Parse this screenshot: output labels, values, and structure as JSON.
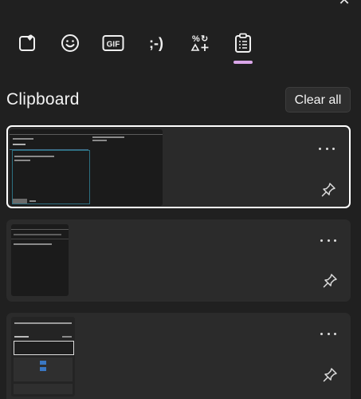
{
  "window": {
    "close_glyph": "✕"
  },
  "tabs": [
    {
      "name": "stickers",
      "icon": "heart-sticker-icon"
    },
    {
      "name": "emoji",
      "icon": "smiley-icon"
    },
    {
      "name": "gif",
      "label": "GIF",
      "icon": "gif-icon"
    },
    {
      "name": "kaomoji",
      "label": ";-)",
      "icon": "kaomoji-icon"
    },
    {
      "name": "symbols",
      "icon": "symbols-icon"
    },
    {
      "name": "clipboard",
      "icon": "clipboard-icon",
      "selected": true
    }
  ],
  "clipboard": {
    "title": "Clipboard",
    "clear_all_label": "Clear all",
    "items": [
      {
        "type": "image",
        "selected": true,
        "more_glyph": "•••",
        "pinned": false
      },
      {
        "type": "image",
        "selected": false,
        "more_glyph": "•••",
        "pinned": false
      },
      {
        "type": "image",
        "selected": false,
        "more_glyph": "•••",
        "pinned": false
      }
    ]
  },
  "colors": {
    "background": "#202020",
    "card": "#2b2b2b",
    "accent_indicator": "#d9a6e8",
    "selected_border": "#ffffff"
  }
}
